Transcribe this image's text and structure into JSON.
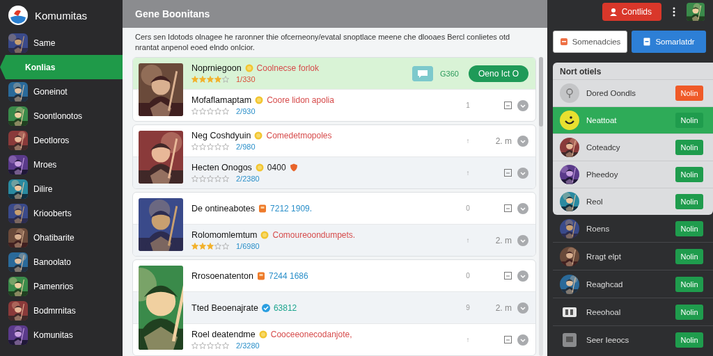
{
  "sidebar": {
    "brand": "Komumitas",
    "items": [
      {
        "label": "Same",
        "selected": false
      },
      {
        "label": "Konlias",
        "selected": true
      },
      {
        "label": "Goneinot",
        "selected": false
      },
      {
        "label": "Soontlonotos",
        "selected": false
      },
      {
        "label": "Deotloros",
        "selected": false
      },
      {
        "label": "Mroes",
        "selected": false
      },
      {
        "label": "Dilire",
        "selected": false
      },
      {
        "label": "Kriooberts",
        "selected": false
      },
      {
        "label": "Ohatibarite",
        "selected": false
      },
      {
        "label": "Banoolato",
        "selected": false
      },
      {
        "label": "Pamenrios",
        "selected": false
      },
      {
        "label": "Bodmrnitas",
        "selected": false
      },
      {
        "label": "Komunitas",
        "selected": false
      }
    ]
  },
  "main": {
    "title": "Gene Boonitans",
    "description": "Cers sen Idotods olnagee he raronner thie ofcerneony/evatal snoptlace meene che dlooaes Bercl conlietes otd nrantat anpenol eoed elndo onlcior.",
    "groups": [
      {
        "rows": [
          {
            "kind": "featured",
            "selected": true,
            "shaded": false,
            "title": "Noprniegoon",
            "badge": {
              "kind": "coin"
            },
            "subtitle": {
              "text": "Coolnecse forlok",
              "color": "#d64b4b"
            },
            "stars": 4,
            "rating": {
              "text": "1/330",
              "color": "#d9503a"
            },
            "count": "G360",
            "action": "Oeno Ict O"
          },
          {
            "kind": "plain",
            "selected": false,
            "shaded": false,
            "title": "Mofaflamaptam",
            "badge": {
              "kind": "coin"
            },
            "subtitle": {
              "text": "Coore lidon apolia",
              "color": "#d64b4b"
            },
            "stars": 0,
            "rating": {
              "text": "2/930",
              "color": "#2a8fc9"
            },
            "mark": "1"
          }
        ]
      },
      {
        "rows": [
          {
            "kind": "plain",
            "selected": false,
            "shaded": false,
            "title": "Neg Coshdyuin",
            "badge": {
              "kind": "coin"
            },
            "subtitle": {
              "text": "Comedetmopoles",
              "color": "#d64b4b"
            },
            "stars": 0,
            "rating": {
              "text": "2/980",
              "color": "#2a8fc9"
            },
            "mark": "↑",
            "time": "2. m"
          },
          {
            "kind": "plain",
            "selected": false,
            "shaded": true,
            "title": "Hecten Onogos",
            "badge": {
              "kind": "coin"
            },
            "subtitle": {
              "text": "0400",
              "color": "#222222"
            },
            "badge2": {
              "kind": "shield"
            },
            "stars": 0,
            "rating": {
              "text": "2/2380",
              "color": "#2a8fc9"
            },
            "mark": "↑"
          }
        ]
      },
      {
        "rows": [
          {
            "kind": "plain",
            "selected": false,
            "shaded": false,
            "title": "De ontineabotes",
            "badge": {
              "kind": "tag"
            },
            "subtitle": {
              "text": "7212 1909.",
              "color": "#2a8fc9"
            },
            "mark": "0"
          },
          {
            "kind": "plain",
            "selected": false,
            "shaded": true,
            "title": "Rolomomlemtum",
            "badge": {
              "kind": "coin"
            },
            "subtitle": {
              "text": "Comoureoondumpets.",
              "color": "#d64b4b"
            },
            "stars": 3,
            "rating": {
              "text": "1/6980",
              "color": "#2a8fc9"
            },
            "mark": "↑",
            "time": "2. m"
          }
        ]
      },
      {
        "rows": [
          {
            "kind": "plain",
            "selected": false,
            "shaded": false,
            "title": "Rrosoenatenton",
            "badge": {
              "kind": "tag"
            },
            "subtitle": {
              "text": "7244 1686",
              "color": "#2a8fc9"
            },
            "mark": "0"
          },
          {
            "kind": "plain",
            "selected": false,
            "shaded": true,
            "title": "Tted Beoenajrate",
            "badge": {
              "kind": "check"
            },
            "subtitle": {
              "text": "63812",
              "color": "#1ca58e"
            },
            "mark": "9",
            "time": "2. m"
          },
          {
            "kind": "plain",
            "selected": false,
            "shaded": false,
            "title": "Roel deatendme",
            "badge": {
              "kind": "coin"
            },
            "subtitle": {
              "text": "Cooceeonecodanjote,",
              "color": "#d64b4b"
            },
            "stars": 0,
            "rating": {
              "text": "2/3280",
              "color": "#2a8fc9"
            },
            "mark": "↑"
          }
        ]
      }
    ]
  },
  "right": {
    "contacts_button": "Contlids",
    "buttons": [
      {
        "label": "Somenadcies",
        "kind": "outline"
      },
      {
        "label": "Somarlatdr",
        "kind": "primary"
      }
    ],
    "panel": {
      "title": "Nort otiels",
      "items": [
        {
          "name": "Dored Oondls",
          "kind": "pin",
          "selected": false,
          "action": {
            "label": "Nolin",
            "kind": "alert"
          }
        },
        {
          "name": "Neattoat",
          "kind": "smiley",
          "selected": true,
          "action": {
            "label": "Nolin",
            "kind": "normal"
          }
        },
        {
          "name": "Coteadcy",
          "kind": "picture",
          "selected": false,
          "action": {
            "label": "Nolin",
            "kind": "normal"
          }
        },
        {
          "name": "Pheedoy",
          "kind": "picture",
          "selected": false,
          "action": {
            "label": "Nolin",
            "kind": "normal"
          }
        },
        {
          "name": "Reol",
          "kind": "picture",
          "selected": false,
          "action": {
            "label": "Nolin",
            "kind": "normal"
          }
        }
      ]
    },
    "more": [
      {
        "name": "Roens",
        "kind": "picture",
        "action": "Nolin"
      },
      {
        "name": "Rragt elpt",
        "kind": "picture",
        "action": "Nolin"
      },
      {
        "name": "Reaghcad",
        "kind": "picture",
        "action": "Nolin"
      },
      {
        "name": "Reeohoal",
        "kind": "film",
        "action": "Nolin"
      },
      {
        "name": "Seer Ieeocs",
        "kind": "screen",
        "action": "Nolin"
      }
    ]
  }
}
